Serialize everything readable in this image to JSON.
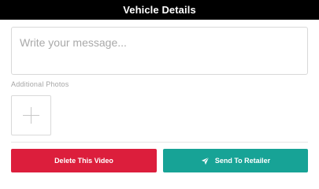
{
  "header": {
    "title": "Vehicle Details"
  },
  "message": {
    "placeholder": "Write your message...",
    "value": ""
  },
  "photos": {
    "label": "Additional Photos",
    "add_icon": "plus-icon"
  },
  "actions": {
    "delete_label": "Delete This Video",
    "send_label": "Send To Retailer",
    "send_icon": "paper-plane-icon"
  },
  "colors": {
    "header_bg": "#000000",
    "delete_button": "#dc1e3c",
    "send_button": "#17a396"
  }
}
